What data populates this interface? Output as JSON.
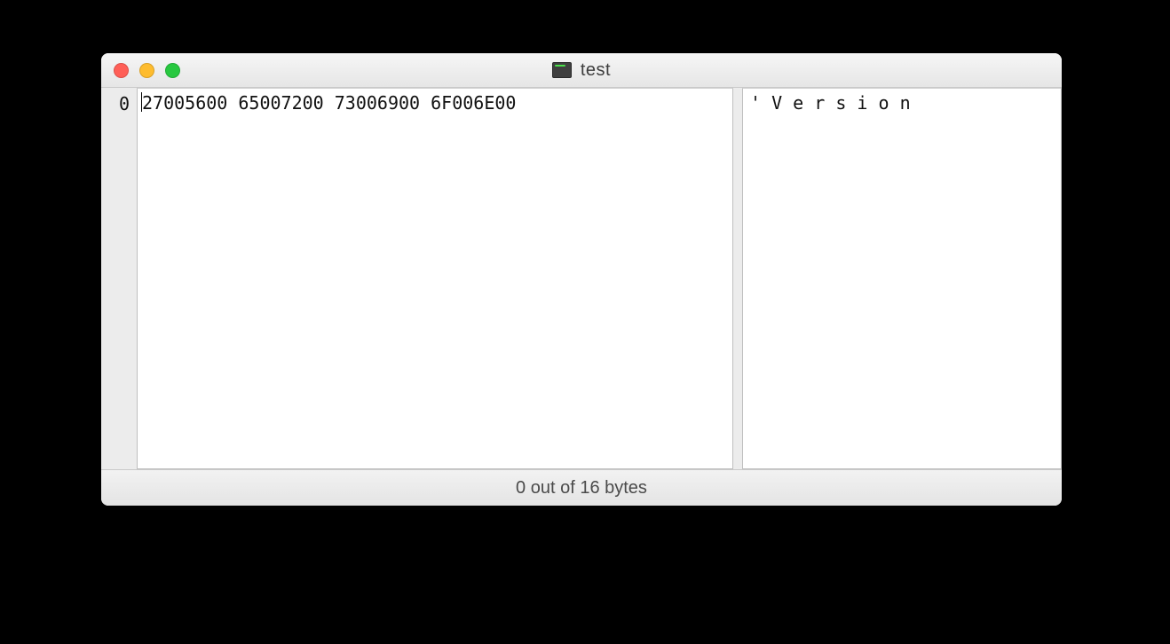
{
  "window": {
    "title": "test"
  },
  "hex": {
    "offset": "0",
    "row": "27005600 65007200 73006900 6F006E00",
    "ascii": "' V e r s i o n"
  },
  "status": {
    "text": "0 out of 16 bytes"
  }
}
